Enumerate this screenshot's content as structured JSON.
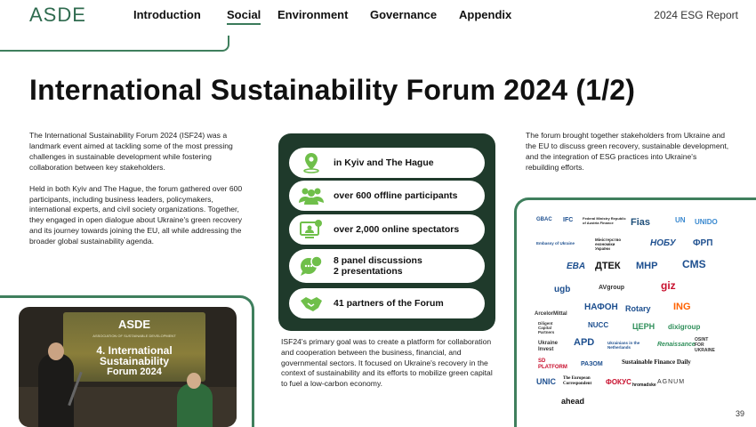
{
  "header": {
    "logo": "ASDE",
    "nav": [
      {
        "label": "Introduction"
      },
      {
        "label": "Social"
      },
      {
        "label": "Environment"
      },
      {
        "label": "Governance"
      },
      {
        "label": "Appendix"
      }
    ],
    "active_nav": "Social",
    "report_label": "2024 ESG Report"
  },
  "page": {
    "title": "International Sustainability Forum 2024 (1/2)",
    "number": "39"
  },
  "left_column": {
    "paragraphs": [
      "The International Sustainability Forum 2024 (ISF24) was a landmark event aimed at tackling some of the most pressing challenges in sustainable development while fostering collaboration between key stakeholders.",
      "Held in both Kyiv and The Hague, the forum gathered over 600 participants, including business leaders, policymakers, international experts, and civil society organizations. Together, they engaged in open dialogue about Ukraine's green recovery and its journey towards joining the EU, all while addressing the broader global sustainability agenda."
    ]
  },
  "photo": {
    "screen_brand": "ASDE",
    "screen_caption": "ASSOCIATION OF SUSTAINABLE DEVELOPMENT",
    "screen_line1": "4. International",
    "screen_line2": "Sustainability",
    "screen_line3": "Forum 2024"
  },
  "stats": [
    {
      "icon": "location-pin-icon",
      "label_1": "in Kyiv and The Hague",
      "label_2": ""
    },
    {
      "icon": "people-group-icon",
      "label_1": "over 600 offline participants",
      "label_2": ""
    },
    {
      "icon": "online-screen-icon",
      "label_1": "over 2,000 online spectators",
      "label_2": ""
    },
    {
      "icon": "chat-bubbles-icon",
      "label_1": "8 panel discussions",
      "label_2": "2 presentations"
    },
    {
      "icon": "handshake-icon",
      "label_1": "41 partners of the Forum",
      "label_2": ""
    }
  ],
  "middle_column": {
    "text": "ISF24's primary goal was to create a platform for collaboration and cooperation between the business, financial, and governmental sectors. It focused on Ukraine's recovery in the context of sustainability and its efforts to mobilize green capital to fuel a low-carbon economy."
  },
  "right_column": {
    "text": "The forum brought together stakeholders from Ukraine and the EU to discuss green recovery, sustainable development, and the integration of ESG practices into Ukraine's rebuilding efforts."
  },
  "partners": [
    {
      "name": "GBAC",
      "color": "#1d4f8f"
    },
    {
      "name": "IFC",
      "color": "#1d4f8f"
    },
    {
      "name": "Federal Ministry Republic of Austria Finance",
      "color": "#222222"
    },
    {
      "name": "Fias",
      "color": "#1f4f7a"
    },
    {
      "name": "UN",
      "color": "#3b8ad0"
    },
    {
      "name": "UNIDO",
      "color": "#3b8ad0"
    },
    {
      "name": "Embassy of Ukraine",
      "color": "#1d4f8f"
    },
    {
      "name": "Міністерство економіки України",
      "color": "#222222"
    },
    {
      "name": "НОБУ",
      "color": "#1d4f8f"
    },
    {
      "name": "ФРП",
      "color": "#1d4f8f"
    },
    {
      "name": "EBA",
      "color": "#1d4f8f"
    },
    {
      "name": "ДТЕК",
      "color": "#111111"
    },
    {
      "name": "МНР",
      "color": "#1d4f8f"
    },
    {
      "name": "CMS",
      "color": "#1d4f8f"
    },
    {
      "name": "ugb",
      "color": "#1d4f8f"
    },
    {
      "name": "AVgroup",
      "color": "#333333"
    },
    {
      "name": "giz",
      "color": "#c8102e"
    },
    {
      "name": "ArcelorMittal",
      "color": "#333333"
    },
    {
      "name": "НАФОН",
      "color": "#1d4f8f"
    },
    {
      "name": "Rotary",
      "color": "#1d4f8f"
    },
    {
      "name": "ING",
      "color": "#ff6200"
    },
    {
      "name": "Diligent Capital Partners",
      "color": "#333333"
    },
    {
      "name": "NUCC",
      "color": "#1d4f8f"
    },
    {
      "name": "ЦЕРН",
      "color": "#2f8f5a"
    },
    {
      "name": "dixigroup",
      "color": "#2f8f5a"
    },
    {
      "name": "Ukraine Invest",
      "color": "#333333"
    },
    {
      "name": "APD",
      "color": "#1d4f8f"
    },
    {
      "name": "Ukrainians in the Netherlands",
      "color": "#1d4f8f"
    },
    {
      "name": "Renaissance",
      "color": "#2f8f5a"
    },
    {
      "name": "OSINT FOR UKRAINE",
      "color": "#333333"
    },
    {
      "name": "SD PLATFORM",
      "color": "#c8102e"
    },
    {
      "name": "РАЗОМ",
      "color": "#1d4f8f"
    },
    {
      "name": "Sustainable Finance Daily",
      "color": "#111111"
    },
    {
      "name": "UNIC",
      "color": "#1d4f8f"
    },
    {
      "name": "The European Correspondent",
      "color": "#111111"
    },
    {
      "name": "ФОКУС",
      "color": "#c8102e"
    },
    {
      "name": "hromadske",
      "color": "#111111"
    },
    {
      "name": "AGNUM",
      "color": "#333333"
    },
    {
      "name": "ahead",
      "color": "#111111"
    }
  ],
  "colors": {
    "brand_green": "#3f7f5d",
    "panel_dark": "#1f3a2b",
    "icon_green": "#6fbf4a"
  }
}
